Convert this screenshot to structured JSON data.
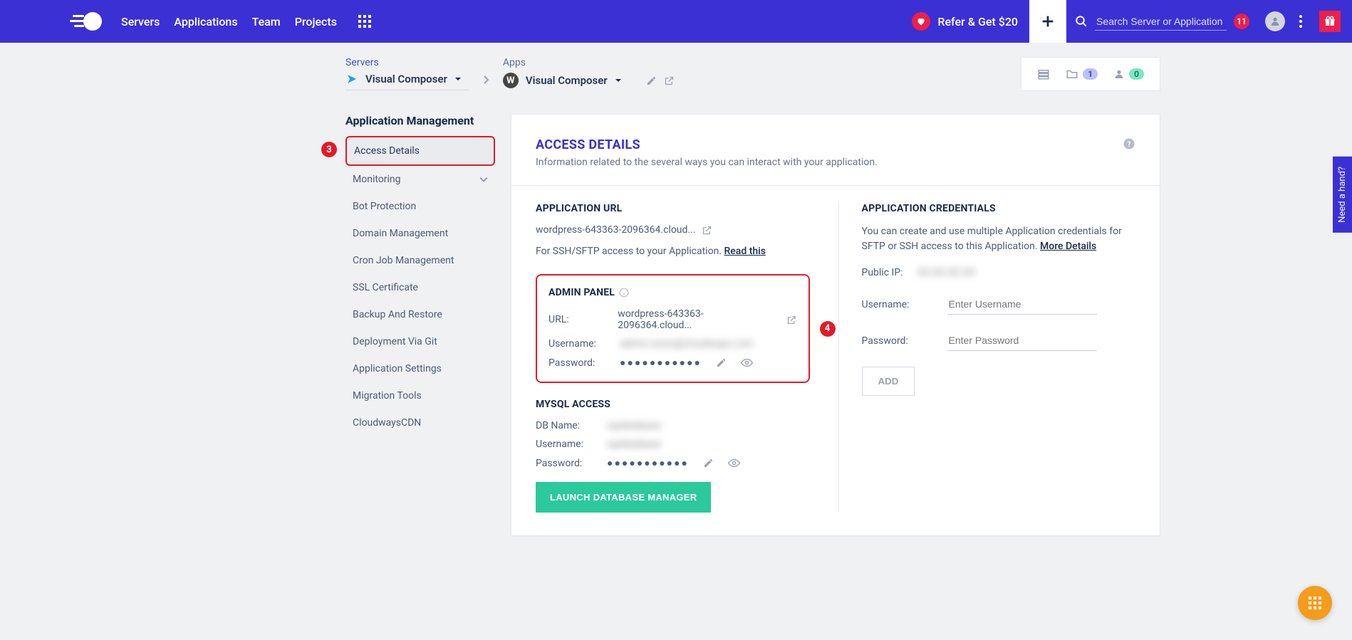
{
  "nav": {
    "links": [
      "Servers",
      "Applications",
      "Team",
      "Projects"
    ],
    "refer": "Refer & Get $20",
    "search_placeholder": "Search Server or Application",
    "notif_count": "11"
  },
  "breadcrumb": {
    "servers_label": "Servers",
    "server_name": "Visual Composer",
    "apps_label": "Apps",
    "app_name": "Visual Composer",
    "meta_folder": "1",
    "meta_user": "0"
  },
  "sidebar": {
    "title": "Application Management",
    "step3": "3",
    "items": [
      "Access Details",
      "Monitoring",
      "Bot Protection",
      "Domain Management",
      "Cron Job Management",
      "SSL Certificate",
      "Backup And Restore",
      "Deployment Via Git",
      "Application Settings",
      "Migration Tools",
      "CloudwaysCDN"
    ]
  },
  "panel": {
    "title": "ACCESS DETAILS",
    "subtitle": "Information related to the several ways you can interact with your application."
  },
  "app_url": {
    "title": "APPLICATION URL",
    "url": "wordpress-643363-2096364.cloud...",
    "ssh_prefix": "For SSH/SFTP access to your Application. ",
    "ssh_link": "Read this"
  },
  "admin": {
    "title": "ADMIN PANEL",
    "step4": "4",
    "url_label": "URL:",
    "url": "wordpress-643363-2096364.cloud...",
    "username_label": "Username:",
    "username": "admin-xxxxx@cloudways.com",
    "password_label": "Password:",
    "password": "●●●●●●●●●●●"
  },
  "mysql": {
    "title": "MYSQL ACCESS",
    "db_label": "DB Name:",
    "db": "wpdatabase",
    "username_label": "Username:",
    "username": "wpdatabase",
    "password_label": "Password:",
    "password": "●●●●●●●●●●●",
    "launch": "LAUNCH DATABASE MANAGER"
  },
  "creds": {
    "title": "APPLICATION CREDENTIALS",
    "text": "You can create and use multiple Application credentials for SFTP or SSH access to this Application. ",
    "more": "More Details",
    "ip_label": "Public IP:",
    "ip": "XX.XX.XX.XX",
    "username_label": "Username:",
    "username_placeholder": "Enter Username",
    "password_label": "Password:",
    "password_placeholder": "Enter Password",
    "add": "ADD"
  },
  "help_tab": "Need a hand?"
}
